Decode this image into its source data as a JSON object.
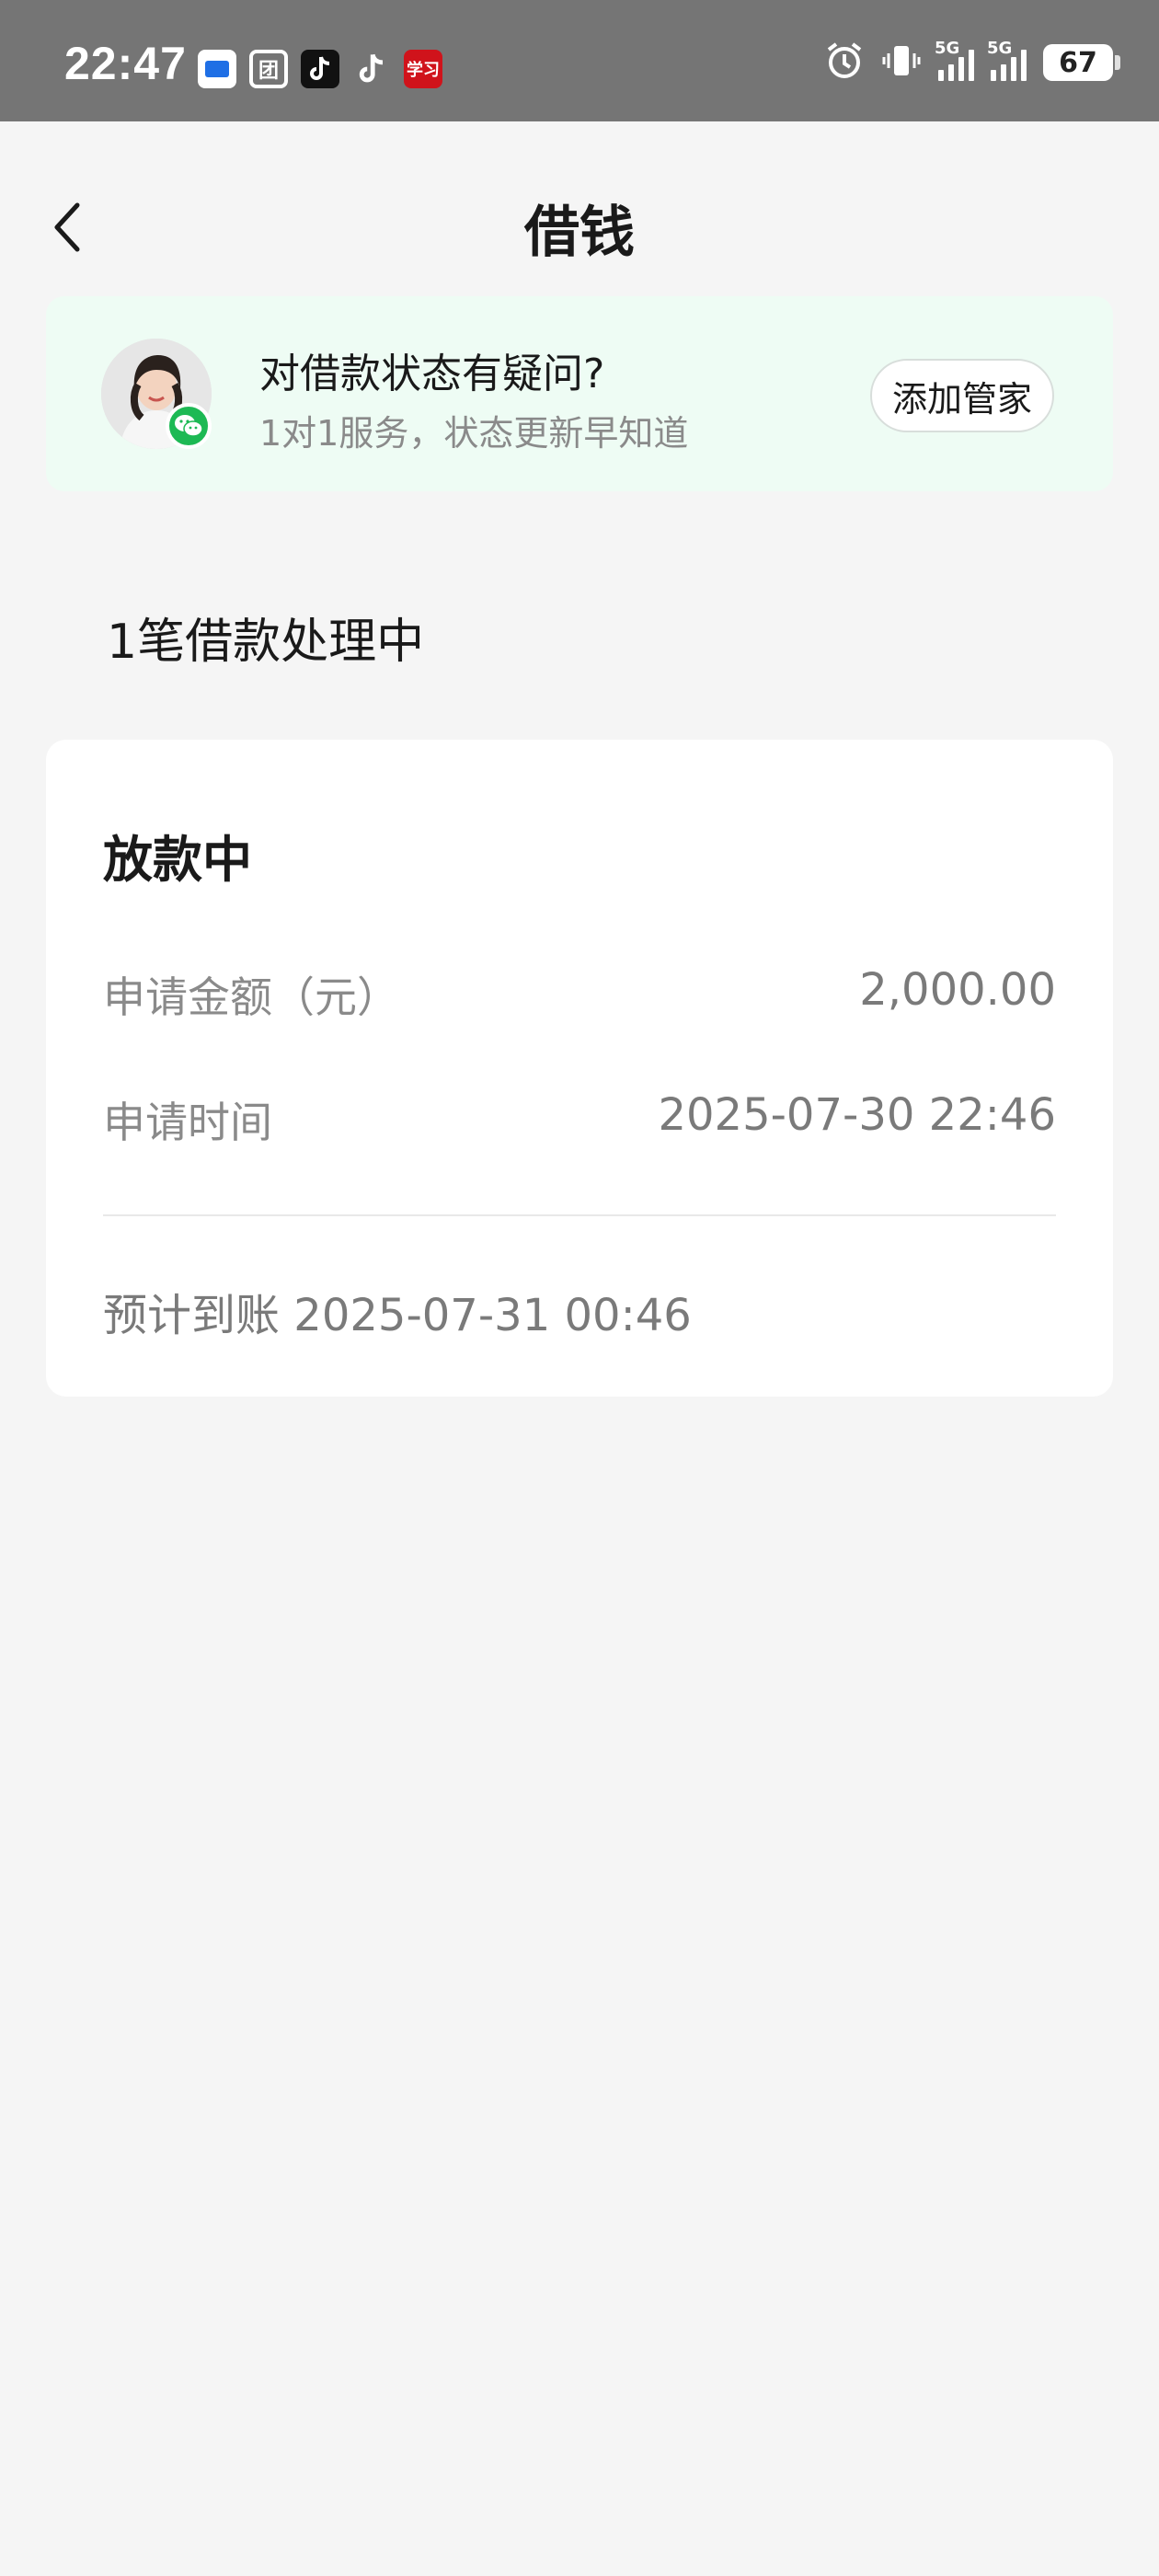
{
  "status_bar": {
    "time": "22:47",
    "network_1": "5G",
    "network_2": "5G",
    "battery": "67",
    "app_icons": [
      "app-icon-blue",
      "tuan-icon",
      "tiktok-lite-icon",
      "tiktok-icon",
      "red-app-icon"
    ],
    "app_icon_texts": [
      "",
      "团",
      "",
      "♪",
      "学习"
    ]
  },
  "header": {
    "title": "借钱",
    "back_icon": "chevron-left-icon"
  },
  "service_banner": {
    "title": "对借款状态有疑问?",
    "subtitle": "1对1服务，状态更新早知道",
    "button_label": "添加管家",
    "badge_icon": "wechat-icon",
    "bg_color": "#eefcf4"
  },
  "section": {
    "heading": "1笔借款处理中"
  },
  "loan_card": {
    "status": "放款中",
    "rows": [
      {
        "label": "申请金额（元）",
        "value": "2,000.00"
      },
      {
        "label": "申请时间",
        "value": "2025-07-30 22:46"
      }
    ],
    "eta_label": "预计到账",
    "eta_value": "2025-07-31 00:46"
  },
  "colors": {
    "status_bar_bg": "#757575",
    "page_bg": "#f5f5f5",
    "accent_green": "#1db954"
  }
}
